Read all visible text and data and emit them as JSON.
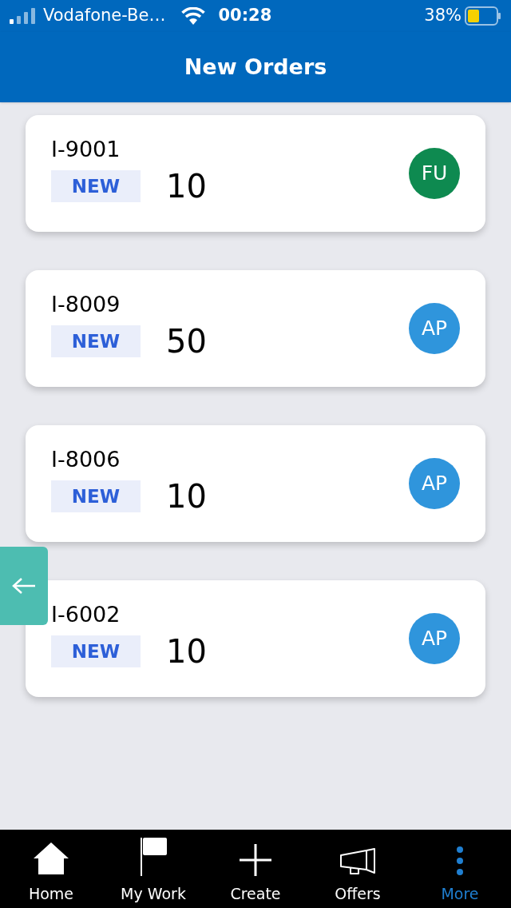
{
  "status_bar": {
    "carrier": "Vodafone-Be…",
    "time": "00:28",
    "battery_percent": "38%"
  },
  "header": {
    "title": "New Orders"
  },
  "orders": [
    {
      "id": "I-9001",
      "status": "NEW",
      "quantity": "10",
      "initials": "FU",
      "color": "#0e8a50"
    },
    {
      "id": "I-8009",
      "status": "NEW",
      "quantity": "50",
      "initials": "AP",
      "color": "#2f95dc"
    },
    {
      "id": "I-8006",
      "status": "NEW",
      "quantity": "10",
      "initials": "AP",
      "color": "#2f95dc"
    },
    {
      "id": "I-6002",
      "status": "NEW",
      "quantity": "10",
      "initials": "AP",
      "color": "#2f95dc"
    }
  ],
  "tabs": [
    {
      "kind": "home",
      "label": "Home",
      "selected": false
    },
    {
      "kind": "flag",
      "label": "My Work",
      "selected": false
    },
    {
      "kind": "plus",
      "label": "Create",
      "selected": false
    },
    {
      "kind": "megaphone",
      "label": "Offers",
      "selected": false
    },
    {
      "kind": "dots",
      "label": "More",
      "selected": true
    }
  ]
}
